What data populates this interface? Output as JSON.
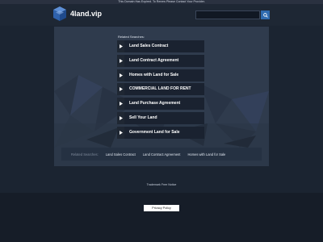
{
  "notice": "This Domain Has Expired. To Renew Please Contact Your Provider.",
  "site": {
    "name": "4land.vip"
  },
  "search": {
    "placeholder": ""
  },
  "related": {
    "label": "Related Searches:",
    "items": [
      "Land Sales Contract",
      "Land Contract Agreement",
      "Homes with Land for Sale",
      "COMMERCIAL LAND FOR RENT",
      "Land Purchase Agreement",
      "Sell Your Land",
      "Government Land for Sale"
    ]
  },
  "bottom_bar": {
    "label": "Related Searches:",
    "links": [
      "Land Sales Contract",
      "Land Contract Agreement",
      "Homes with Land for Sale"
    ]
  },
  "footer": {
    "trademark": "Trademark Free Notice",
    "privacy": "Privacy Policy"
  },
  "colors": {
    "accent": "#2f6bb0",
    "background": "#1b2431",
    "panel": "#2e3a4c"
  },
  "icons": {
    "logo": "cube-icon",
    "search": "search-icon",
    "arrow": "play-arrow-icon"
  }
}
